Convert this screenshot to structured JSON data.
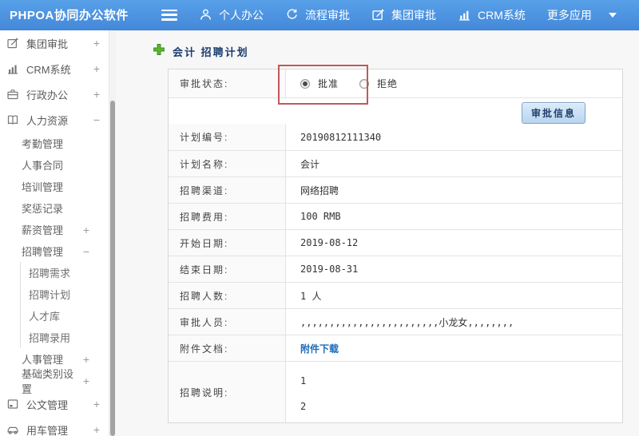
{
  "colors": {
    "topbar_blue": "#4a91dd",
    "annotation_red": "#c2585b",
    "link_blue": "#1e6bb8",
    "plus_green": "#5cb431"
  },
  "topbar": {
    "brand": "PHPOA协同办公软件",
    "items": [
      {
        "label": "个人办公",
        "icon": "person-icon"
      },
      {
        "label": "流程审批",
        "icon": "flow-icon"
      },
      {
        "label": "集团审批",
        "icon": "edit-icon"
      },
      {
        "label": "CRM系统",
        "icon": "chart-icon"
      },
      {
        "label": "更多应用",
        "icon": "caret-down-icon"
      }
    ]
  },
  "sidebar": {
    "items": [
      {
        "label": "集团审批",
        "icon": "edit-icon",
        "expand": "+",
        "level": 0
      },
      {
        "label": "CRM系统",
        "icon": "chart-icon",
        "expand": "+",
        "level": 0
      },
      {
        "label": "行政办公",
        "icon": "briefcase-icon",
        "expand": "+",
        "level": 0
      },
      {
        "label": "人力资源",
        "icon": "book-icon",
        "expand": "−",
        "level": 0
      },
      {
        "label": "考勤管理",
        "level": 1
      },
      {
        "label": "人事合同",
        "level": 1
      },
      {
        "label": "培训管理",
        "level": 1
      },
      {
        "label": "奖惩记录",
        "level": 1
      },
      {
        "label": "薪资管理",
        "expand": "+",
        "level": 1
      },
      {
        "label": "招聘管理",
        "expand": "−",
        "level": 1
      },
      {
        "label": "招聘需求",
        "level": 2
      },
      {
        "label": "招聘计划",
        "level": 2
      },
      {
        "label": "人才库",
        "level": 2
      },
      {
        "label": "招聘录用",
        "level": 2
      },
      {
        "label": "人事管理",
        "expand": "+",
        "level": 1
      },
      {
        "label": "基础类别设置",
        "expand": "+",
        "level": 1
      },
      {
        "label": "公文管理",
        "icon": "doc-icon",
        "expand": "+",
        "level": 0
      },
      {
        "label": "用车管理",
        "icon": "car-icon",
        "expand": "+",
        "level": 0
      }
    ]
  },
  "main": {
    "title": "会计 招聘计划",
    "approval": {
      "label": "审批状态:",
      "approve": "批准",
      "reject": "拒绝",
      "selected": "approve",
      "button": "审批信息"
    },
    "rows": [
      {
        "label": "计划编号:",
        "value": "20190812111340"
      },
      {
        "label": "计划名称:",
        "value": "会计"
      },
      {
        "label": "招聘渠道:",
        "value": "网络招聘"
      },
      {
        "label": "招聘费用:",
        "value": "100 RMB"
      },
      {
        "label": "开始日期:",
        "value": "2019-08-12"
      },
      {
        "label": "结束日期:",
        "value": "2019-08-31"
      },
      {
        "label": "招聘人数:",
        "value": "1 人"
      },
      {
        "label": "审批人员:",
        "value": ",,,,,,,,,,,,,,,,,,,,,,,,小龙女,,,,,,,,"
      },
      {
        "label": "附件文档:",
        "value": "附件下载",
        "link": true
      },
      {
        "label": "招聘说明:",
        "lines": [
          "1",
          "2"
        ]
      }
    ]
  }
}
